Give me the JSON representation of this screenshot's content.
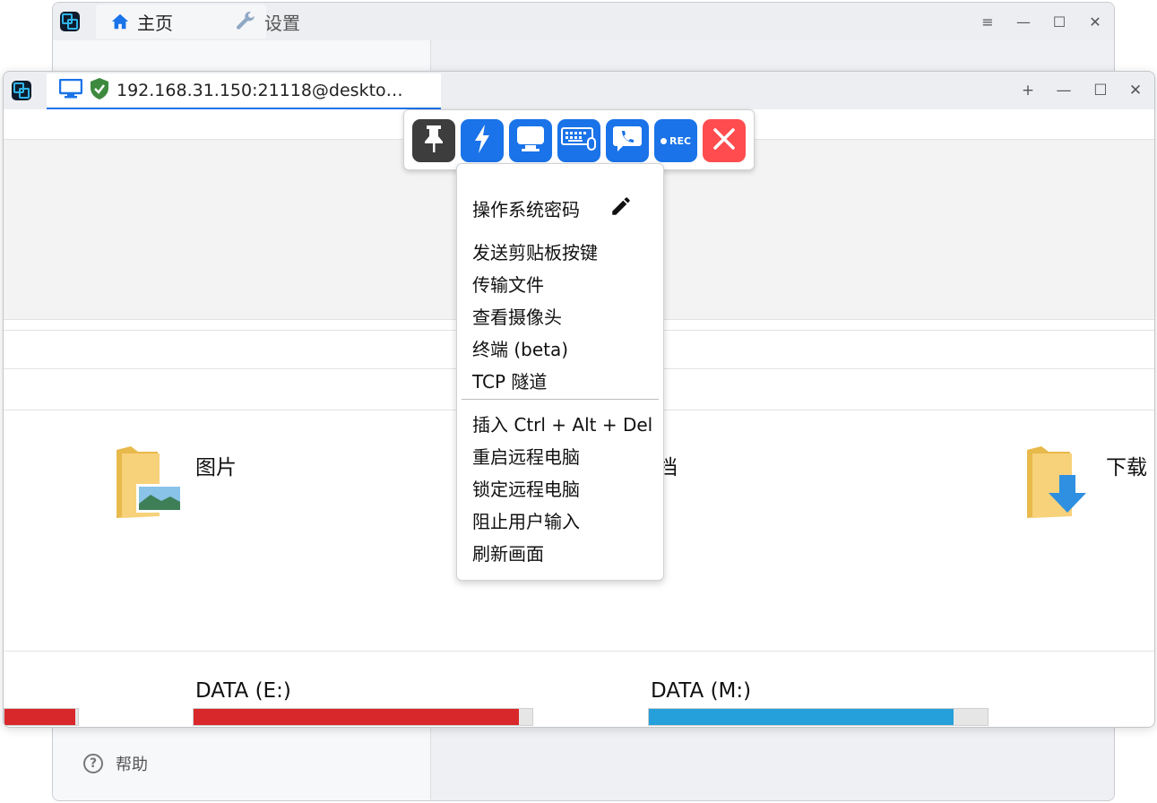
{
  "back_window": {
    "tabs": [
      {
        "label": "主页",
        "icon": "home-icon"
      },
      {
        "label": "设置",
        "icon": "wrench-icon"
      }
    ],
    "help_label": "帮助"
  },
  "front_window": {
    "session_tab": {
      "title": "192.168.31.150:21118@deskto…",
      "icons": [
        "monitor-icon",
        "shield-check-icon"
      ]
    },
    "toolbar": {
      "buttons": [
        {
          "name": "pin",
          "icon": "pin-icon",
          "color": "#3d3d3d"
        },
        {
          "name": "action",
          "icon": "lightning-icon",
          "color": "#1a73e8"
        },
        {
          "name": "display",
          "icon": "monitor-icon",
          "color": "#1a73e8"
        },
        {
          "name": "keyboard",
          "icon": "keyboard-icon",
          "color": "#1a73e8"
        },
        {
          "name": "chat",
          "icon": "chat-phone-icon",
          "color": "#1a73e8"
        },
        {
          "name": "record",
          "icon": "record-icon",
          "label": "REC",
          "color": "#1a73e8"
        },
        {
          "name": "close",
          "icon": "close-icon",
          "color": "#ff4d4f"
        }
      ]
    },
    "menu": {
      "items_top": [
        "操作系统密码",
        "发送剪贴板按键",
        "传输文件",
        "查看摄像头",
        "终端 (beta)",
        "TCP 隧道"
      ],
      "items_bottom": [
        "插入 Ctrl + Alt + Del",
        "重启远程电脑",
        "锁定远程电脑",
        "阻止用户输入",
        "刷新画面"
      ]
    },
    "remote_desktop": {
      "folders": [
        {
          "label": "图片",
          "icon": "pictures-folder-icon"
        },
        {
          "label": "文档",
          "icon": "documents-folder-icon"
        },
        {
          "label": "下载",
          "icon": "downloads-folder-icon"
        }
      ],
      "drives": [
        {
          "label": "DATA (E:)",
          "used_fraction": 0.96,
          "color": "#d9282b"
        },
        {
          "label": "DATA (M:)",
          "used_fraction": 0.9,
          "color": "#26a0da"
        }
      ],
      "partial_drive_color": "#d9282b"
    }
  }
}
